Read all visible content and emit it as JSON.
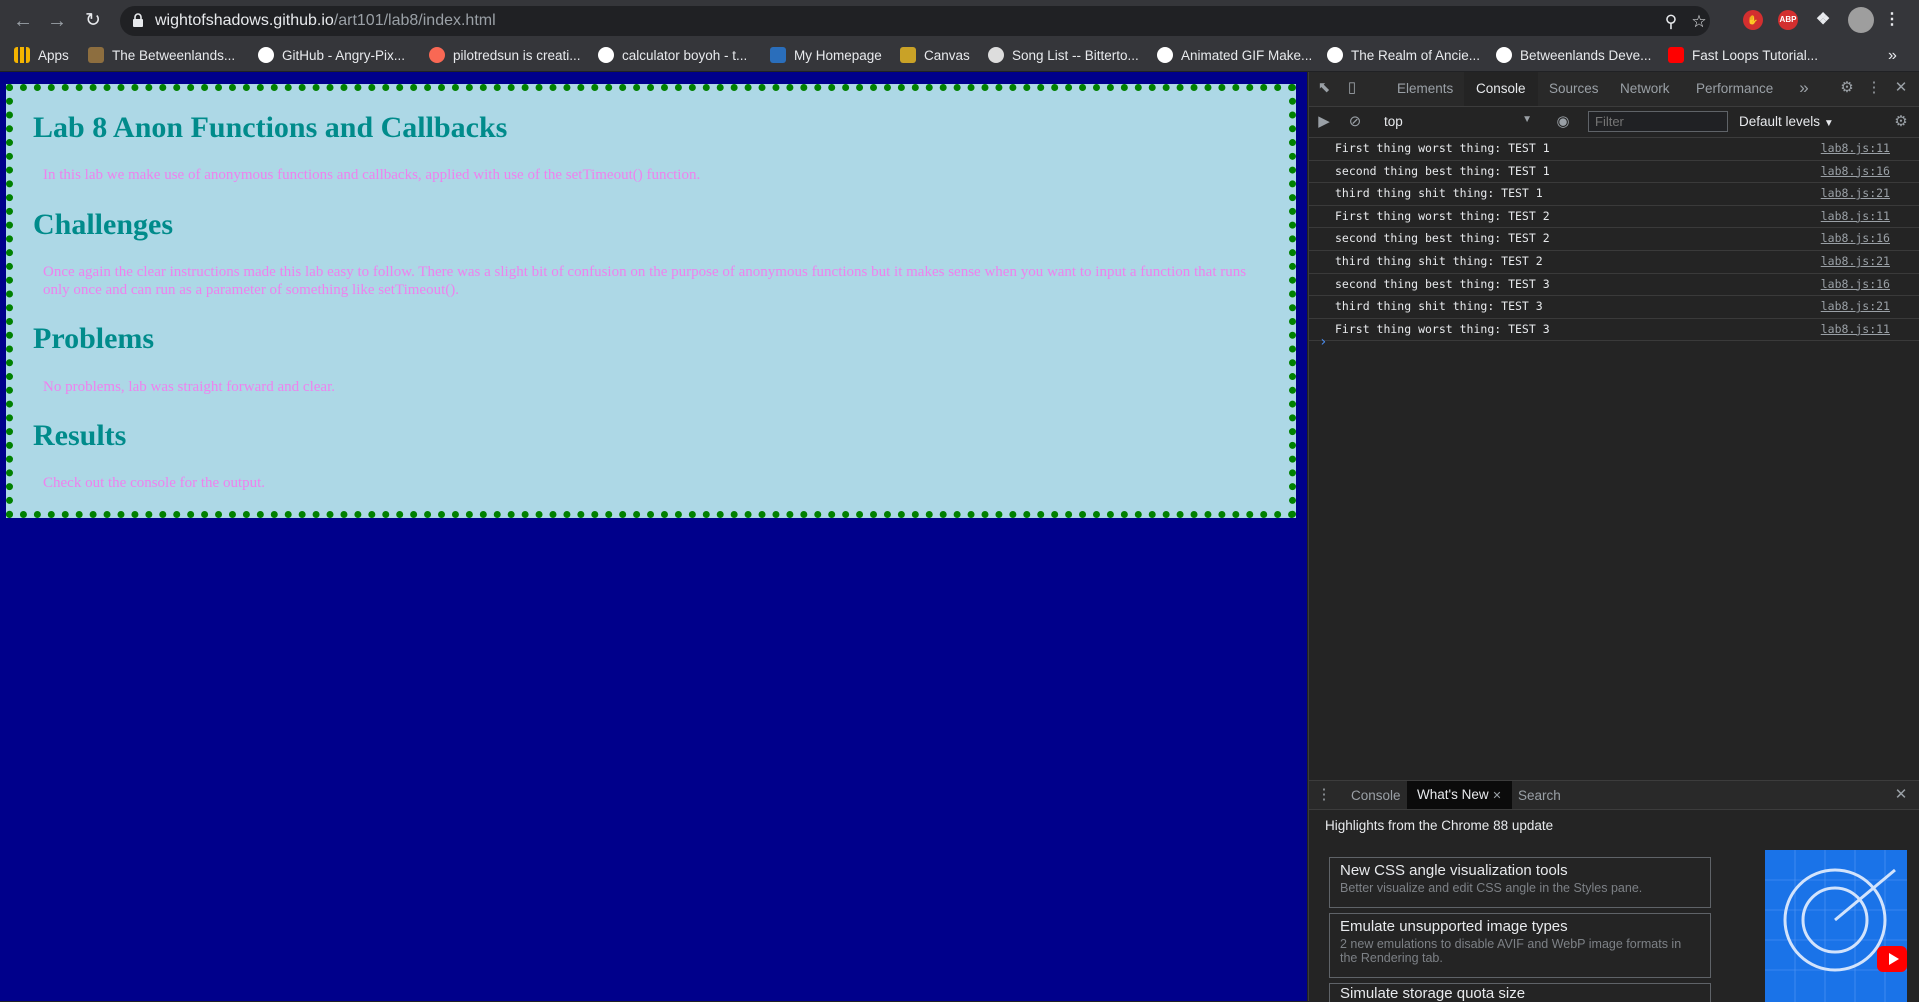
{
  "browser": {
    "url_host": "wightofshadows.github.io",
    "url_path": "/art101/lab8/index.html",
    "extensions": [
      {
        "name": "adblock-plus",
        "label": "ABP",
        "color": "#d32f2f"
      }
    ]
  },
  "bookmarks": [
    {
      "label": "Apps",
      "icon": "apps-grid-icon",
      "color": "#f4b400"
    },
    {
      "label": "The Betweenlands...",
      "icon": "betweenlands-icon",
      "color": "#8d6e3f"
    },
    {
      "label": "GitHub - Angry-Pix...",
      "icon": "github-icon",
      "color": "#ffffff"
    },
    {
      "label": "pilotredsun is creati...",
      "icon": "patreon-icon",
      "color": "#f96854"
    },
    {
      "label": "calculator boyoh - t...",
      "icon": "google-icon",
      "color": "#ffffff"
    },
    {
      "label": "My Homepage",
      "icon": "ucsc-icon",
      "color": "#2a6ebb"
    },
    {
      "label": "Canvas",
      "icon": "canvas-icon",
      "color": "#c9a227"
    },
    {
      "label": "Song List -- Bitterto...",
      "icon": "song-list-icon",
      "color": "#dddddd"
    },
    {
      "label": "Animated GIF Make...",
      "icon": "gif-maker-icon",
      "color": "#ffffff"
    },
    {
      "label": "The Realm of Ancie...",
      "icon": "realm-icon",
      "color": "#ffffff"
    },
    {
      "label": "Betweenlands Deve...",
      "icon": "github-icon",
      "color": "#ffffff"
    },
    {
      "label": "Fast Loops Tutorial...",
      "icon": "youtube-icon",
      "color": "#ff0000"
    }
  ],
  "page": {
    "sections": [
      {
        "heading": "Lab 8 Anon Functions and Callbacks",
        "body": "In this lab we make use of anonymous functions and callbacks, applied with use of the setTimeout() function."
      },
      {
        "heading": "Challenges",
        "body": "Once again the clear instructions made this lab easy to follow. There was a slight bit of confusion on the purpose of anonymous functions but it makes sense when you want to input a function that runs only once and can run as a parameter of something like setTimeout()."
      },
      {
        "heading": "Problems",
        "body": "No problems, lab was straight forward and clear."
      },
      {
        "heading": "Results",
        "body": "Check out the console for the output."
      }
    ],
    "colors": {
      "background": "#00008b",
      "card": "#add8e6",
      "border": "#008000",
      "heading": "#008b8b",
      "text": "#ee82ee"
    }
  },
  "devtools": {
    "tabs": [
      "Elements",
      "Console",
      "Sources",
      "Network",
      "Performance"
    ],
    "active_tab": "Console",
    "context": "top",
    "filter_placeholder": "Filter",
    "levels": "Default levels",
    "console_rows": [
      {
        "msg": "First thing worst thing: TEST 1",
        "src": "lab8.js:11"
      },
      {
        "msg": "second thing best thing: TEST 1",
        "src": "lab8.js:16"
      },
      {
        "msg": "third thing shit thing: TEST 1",
        "src": "lab8.js:21"
      },
      {
        "msg": "First thing worst thing: TEST 2",
        "src": "lab8.js:11"
      },
      {
        "msg": "second thing best thing: TEST 2",
        "src": "lab8.js:16"
      },
      {
        "msg": "third thing shit thing: TEST 2",
        "src": "lab8.js:21"
      },
      {
        "msg": "second thing best thing: TEST 3",
        "src": "lab8.js:16"
      },
      {
        "msg": "third thing shit thing: TEST 3",
        "src": "lab8.js:21"
      },
      {
        "msg": "First thing worst thing: TEST 3",
        "src": "lab8.js:11"
      }
    ],
    "drawer": {
      "tabs": [
        "Console",
        "What's New",
        "Search"
      ],
      "active_tab": "What's New",
      "headline": "Highlights from the Chrome 88 update",
      "cards": [
        {
          "title": "New CSS angle visualization tools",
          "desc": "Better visualize and edit CSS angle in the Styles pane."
        },
        {
          "title": "Emulate unsupported image types",
          "desc": "2 new emulations to disable AVIF and WebP image formats in the Rendering tab."
        },
        {
          "title": "Simulate storage quota size",
          "desc": ""
        }
      ]
    }
  }
}
